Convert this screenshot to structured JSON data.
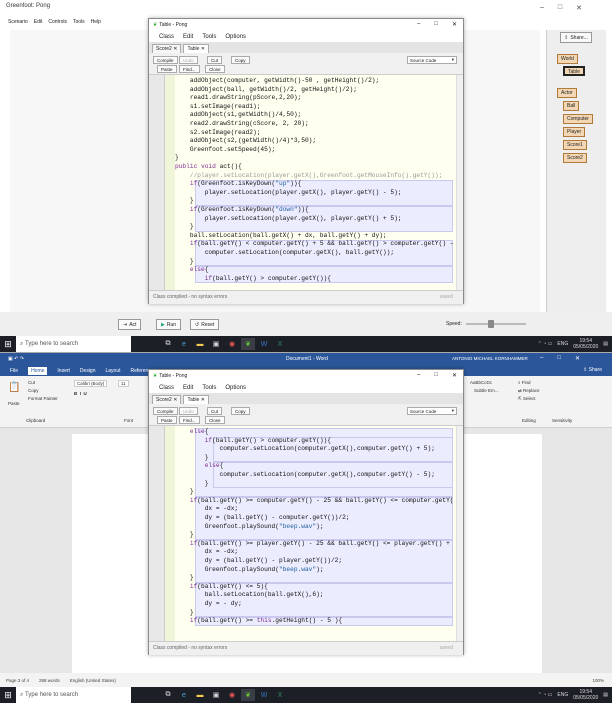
{
  "taskbar": {
    "search_placeholder": "Type here to search",
    "time": "19:54",
    "date": "05/05/2020",
    "lang": "ENG"
  },
  "greenfoot": {
    "title": "Greenfoot: Pong",
    "menu": [
      "Scenario",
      "Edit",
      "Controls",
      "Tools",
      "Help"
    ],
    "share_label": "Share...",
    "world_classes": [
      "World",
      "Table"
    ],
    "actor_classes": [
      "Actor",
      "Ball",
      "Computer",
      "Player",
      "Score1",
      "Score2"
    ],
    "act_label": "Act",
    "run_label": "Run",
    "reset_label": "Reset",
    "speed_label": "Speed:"
  },
  "editor": {
    "title": "Table - Pong",
    "menu": [
      "Class",
      "Edit",
      "Tools",
      "Options"
    ],
    "tabs": [
      "Score2",
      "Table"
    ],
    "tools": [
      "Compile",
      "Undo",
      "Cut",
      "Copy",
      "Paste",
      "Find...",
      "Close"
    ],
    "source_mode": "Source Code",
    "status": "Class compiled - no syntax errors",
    "status_right": "saved"
  },
  "code_top": [
    "    addObject(computer, getWidth()-50 , getHeight()/2);",
    "    addObject(ball, getWidth()/2, getHeight()/2);",
    "    read1.drawString(pScore,2,20);",
    "    s1.setImage(read1);",
    "    addObject(s1,getWidth()/4,50);",
    "    read2.drawString(cScore, 2, 20);",
    "    s2.setImage(read2);",
    "    addObject(s2,(getWidth()/4)*3,50);",
    "    Greenfoot.setSpeed(45);",
    "}",
    "public void act(){",
    "    //player.setLocation(player.getX(),Greenfoot.getMouseInfo().getY());",
    "    if(Greenfoot.isKeyDown(\"up\")){",
    "        player.setLocation(player.getX(), player.getY() - 5);",
    "    }",
    "    if(Greenfoot.isKeyDown(\"down\")){",
    "        player.setLocation(player.getX(), player.getY() + 5);",
    "    }",
    "    ball.setLocation(ball.getX() + dx, ball.getY() + dy);",
    "    if(ball.getY() < computer.getY() + 5 && ball.getY() > computer.getY() -",
    "        computer.setLocation(computer.getX(), ball.getY());",
    "    }",
    "    else{",
    "        if(ball.getY() > computer.getY()){"
  ],
  "code_bottom": [
    "    else{",
    "        if(ball.getY() > computer.getY()){",
    "            computer.setLocation(computer.getX(),computer.getY() + 5);",
    "        }",
    "        else{",
    "            computer.setLocation(computer.getX(),computer.getY() - 5);",
    "        }",
    "    }",
    "    if(ball.getY() >= computer.getY() - 25 && ball.getY() <= computer.getY(",
    "        dx = -dx;",
    "        dy = (ball.getY() - computer.getY())/2;",
    "        Greenfoot.playSound(\"beep.wav\");",
    "    }",
    "    if(ball.getY() >= player.getY() - 25 && ball.getY() <= player.getY() +",
    "        dx = -dx;",
    "        dy = (ball.getY() - player.getY())/2;",
    "        Greenfoot.playSound(\"beep.wav\");",
    "    }",
    "    if(ball.getY() <= 5){",
    "        ball.setLocation(ball.getX(),6);",
    "        dy = - dy;",
    "    }",
    "    if(ball.getY() >= this.getHeight() - 5 ){"
  ],
  "word": {
    "title": "Document1 - Word",
    "user": "ANTONIO MICHAEL KORNHAMMER",
    "tabs": [
      "File",
      "Home",
      "Insert",
      "Design",
      "Layout",
      "References"
    ],
    "share_label": "Share",
    "font": "Calibri (Body)",
    "font_size": "11",
    "clipboard": [
      "Cut",
      "Copy",
      "Format Painter"
    ],
    "paste_label": "Paste",
    "group_clipboard": "Clipboard",
    "group_font": "Font",
    "group_editing": "Editing",
    "group_sensitivity": "Sensitivity",
    "styles": [
      "AaBbCcDc",
      "Subtle Em..."
    ],
    "editing": [
      "Find",
      "Replace",
      "Select"
    ],
    "status_page": "Page 3 of 4",
    "status_words": "288 words",
    "status_lang": "English (United States)",
    "zoom": "100%"
  }
}
